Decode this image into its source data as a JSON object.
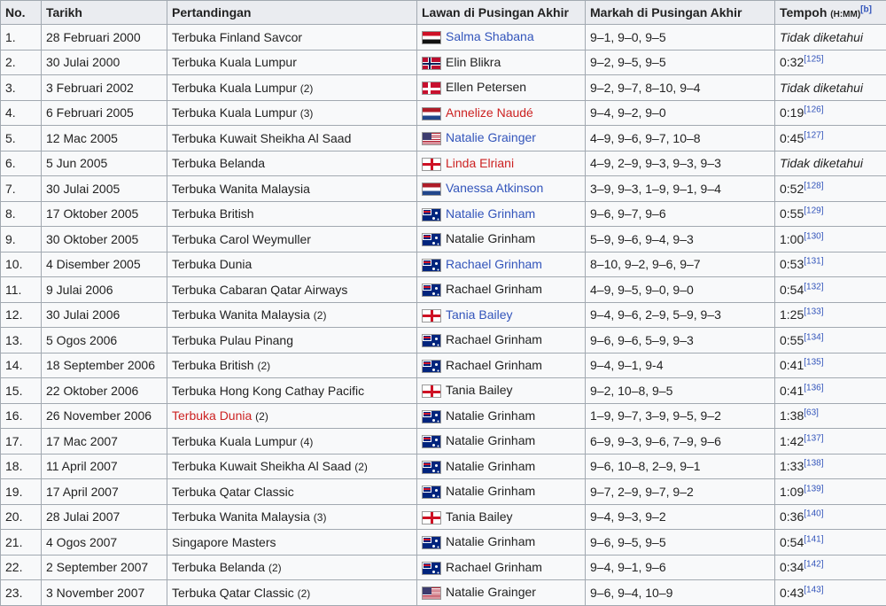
{
  "headers": {
    "no": "No.",
    "date": "Tarikh",
    "tournament": "Pertandingan",
    "opponent": "Lawan di Pusingan Akhir",
    "score": "Markah di Pusingan Akhir",
    "duration": "Tempoh",
    "duration_unit": "(H:MM)",
    "duration_ref": "[b]"
  },
  "unknown_text": "Tidak diketahui",
  "rows": [
    {
      "no": "1.",
      "date": "28 Februari 2000",
      "tournament": "Terbuka Finland Savcor",
      "count": "",
      "t_color": "normal",
      "opponent": "Salma Shabana",
      "flag": "egypt",
      "o_color": "link",
      "score": "9–1, 9–0, 9–5",
      "duration": "Tidak diketahui",
      "ref": ""
    },
    {
      "no": "2.",
      "date": "30 Julai 2000",
      "tournament": "Terbuka Kuala Lumpur",
      "count": "",
      "t_color": "normal",
      "opponent": "Elin Blikra",
      "flag": "norway",
      "o_color": "normal",
      "score": "9–2, 9–5, 9–5",
      "duration": "0:32",
      "ref": "[125]"
    },
    {
      "no": "3.",
      "date": "3 Februari 2002",
      "tournament": "Terbuka Kuala Lumpur",
      "count": "(2)",
      "t_color": "normal",
      "opponent": "Ellen Petersen",
      "flag": "denmark",
      "o_color": "normal",
      "score": "9–2, 9–7, 8–10, 9–4",
      "duration": "Tidak diketahui",
      "ref": ""
    },
    {
      "no": "4.",
      "date": "6 Februari 2005",
      "tournament": "Terbuka Kuala Lumpur",
      "count": "(3)",
      "t_color": "normal",
      "opponent": "Annelize Naudé",
      "flag": "netherlands",
      "o_color": "red",
      "score": "9–4, 9–2, 9–0",
      "duration": "0:19",
      "ref": "[126]"
    },
    {
      "no": "5.",
      "date": "12 Mac 2005",
      "tournament": "Terbuka Kuwait Sheikha Al Saad",
      "count": "",
      "t_color": "normal",
      "opponent": "Natalie Grainger",
      "flag": "usa",
      "o_color": "link",
      "score": "4–9, 9–6, 9–7, 10–8",
      "duration": "0:45",
      "ref": "[127]"
    },
    {
      "no": "6.",
      "date": "5 Jun 2005",
      "tournament": "Terbuka Belanda",
      "count": "",
      "t_color": "normal",
      "opponent": "Linda Elriani",
      "flag": "england",
      "o_color": "red",
      "score": "4–9, 2–9, 9–3, 9–3, 9–3",
      "duration": "Tidak diketahui",
      "ref": ""
    },
    {
      "no": "7.",
      "date": "30 Julai 2005",
      "tournament": "Terbuka Wanita Malaysia",
      "count": "",
      "t_color": "normal",
      "opponent": "Vanessa Atkinson",
      "flag": "netherlands",
      "o_color": "link",
      "score": "3–9, 9–3, 1–9, 9–1, 9–4",
      "duration": "0:52",
      "ref": "[128]"
    },
    {
      "no": "8.",
      "date": "17 Oktober 2005",
      "tournament": "Terbuka British",
      "count": "",
      "t_color": "normal",
      "opponent": "Natalie Grinham",
      "flag": "australia",
      "o_color": "link",
      "score": "9–6, 9–7, 9–6",
      "duration": "0:55",
      "ref": "[129]"
    },
    {
      "no": "9.",
      "date": "30 Oktober 2005",
      "tournament": "Terbuka Carol Weymuller",
      "count": "",
      "t_color": "normal",
      "opponent": "Natalie Grinham",
      "flag": "australia",
      "o_color": "normal",
      "score": "5–9, 9–6, 9–4, 9–3",
      "duration": "1:00",
      "ref": "[130]"
    },
    {
      "no": "10.",
      "date": "4 Disember 2005",
      "tournament": "Terbuka Dunia",
      "count": "",
      "t_color": "normal",
      "opponent": "Rachael Grinham",
      "flag": "australia",
      "o_color": "link",
      "score": "8–10, 9–2, 9–6, 9–7",
      "duration": "0:53",
      "ref": "[131]"
    },
    {
      "no": "11.",
      "date": "9 Julai 2006",
      "tournament": "Terbuka Cabaran Qatar Airways",
      "count": "",
      "t_color": "normal",
      "opponent": "Rachael Grinham",
      "flag": "australia",
      "o_color": "normal",
      "score": "4–9, 9–5, 9–0, 9–0",
      "duration": "0:54",
      "ref": "[132]"
    },
    {
      "no": "12.",
      "date": "30 Julai 2006",
      "tournament": "Terbuka Wanita Malaysia",
      "count": "(2)",
      "t_color": "normal",
      "opponent": "Tania Bailey",
      "flag": "england",
      "o_color": "link",
      "score": "9–4, 9–6, 2–9, 5–9, 9–3",
      "duration": "1:25",
      "ref": "[133]"
    },
    {
      "no": "13.",
      "date": "5 Ogos 2006",
      "tournament": "Terbuka Pulau Pinang",
      "count": "",
      "t_color": "normal",
      "opponent": "Rachael Grinham",
      "flag": "australia",
      "o_color": "normal",
      "score": "9–6, 9–6, 5–9, 9–3",
      "duration": "0:55",
      "ref": "[134]"
    },
    {
      "no": "14.",
      "date": "18 September 2006",
      "tournament": "Terbuka British",
      "count": "(2)",
      "t_color": "normal",
      "opponent": "Rachael Grinham",
      "flag": "australia",
      "o_color": "normal",
      "score": "9–4, 9–1, 9-4",
      "duration": "0:41",
      "ref": "[135]"
    },
    {
      "no": "15.",
      "date": "22 Oktober 2006",
      "tournament": "Terbuka Hong Kong Cathay Pacific",
      "count": "",
      "t_color": "normal",
      "opponent": "Tania Bailey",
      "flag": "england",
      "o_color": "normal",
      "score": "9–2, 10–8, 9–5",
      "duration": "0:41",
      "ref": "[136]"
    },
    {
      "no": "16.",
      "date": "26 November 2006",
      "tournament": "Terbuka Dunia",
      "count": "(2)",
      "t_color": "red",
      "opponent": "Natalie Grinham",
      "flag": "australia",
      "o_color": "normal",
      "score": "1–9, 9–7, 3–9, 9–5, 9–2",
      "duration": "1:38",
      "ref": "[63]"
    },
    {
      "no": "17.",
      "date": "17 Mac 2007",
      "tournament": "Terbuka Kuala Lumpur",
      "count": "(4)",
      "t_color": "normal",
      "opponent": "Natalie Grinham",
      "flag": "australia",
      "o_color": "normal",
      "score": "6–9, 9–3, 9–6, 7–9, 9–6",
      "duration": "1:42",
      "ref": "[137]"
    },
    {
      "no": "18.",
      "date": "11 April 2007",
      "tournament": "Terbuka Kuwait Sheikha Al Saad",
      "count": "(2)",
      "t_color": "normal",
      "opponent": "Natalie Grinham",
      "flag": "australia",
      "o_color": "normal",
      "score": "9–6, 10–8, 2–9, 9–1",
      "duration": "1:33",
      "ref": "[138]"
    },
    {
      "no": "19.",
      "date": "17 April 2007",
      "tournament": "Terbuka Qatar Classic",
      "count": "",
      "t_color": "normal",
      "opponent": "Natalie Grinham",
      "flag": "australia",
      "o_color": "normal",
      "score": "9–7, 2–9, 9–7, 9–2",
      "duration": "1:09",
      "ref": "[139]"
    },
    {
      "no": "20.",
      "date": "28 Julai 2007",
      "tournament": "Terbuka Wanita Malaysia",
      "count": "(3)",
      "t_color": "normal",
      "opponent": "Tania Bailey",
      "flag": "england",
      "o_color": "normal",
      "score": "9–4, 9–3, 9–2",
      "duration": "0:36",
      "ref": "[140]"
    },
    {
      "no": "21.",
      "date": "4 Ogos 2007",
      "tournament": "Singapore Masters",
      "count": "",
      "t_color": "normal",
      "opponent": "Natalie Grinham",
      "flag": "australia",
      "o_color": "normal",
      "score": "9–6, 9–5, 9–5",
      "duration": "0:54",
      "ref": "[141]"
    },
    {
      "no": "22.",
      "date": "2 September 2007",
      "tournament": "Terbuka Belanda",
      "count": "(2)",
      "t_color": "normal",
      "opponent": "Rachael Grinham",
      "flag": "australia",
      "o_color": "normal",
      "score": "9–4, 9–1, 9–6",
      "duration": "0:34",
      "ref": "[142]"
    },
    {
      "no": "23.",
      "date": "3 November 2007",
      "tournament": "Terbuka Qatar Classic",
      "count": "(2)",
      "t_color": "normal",
      "opponent": "Natalie Grainger",
      "flag": "usa",
      "o_color": "normal",
      "score": "9–6, 9–4, 10–9",
      "duration": "0:43",
      "ref": "[143]"
    }
  ]
}
